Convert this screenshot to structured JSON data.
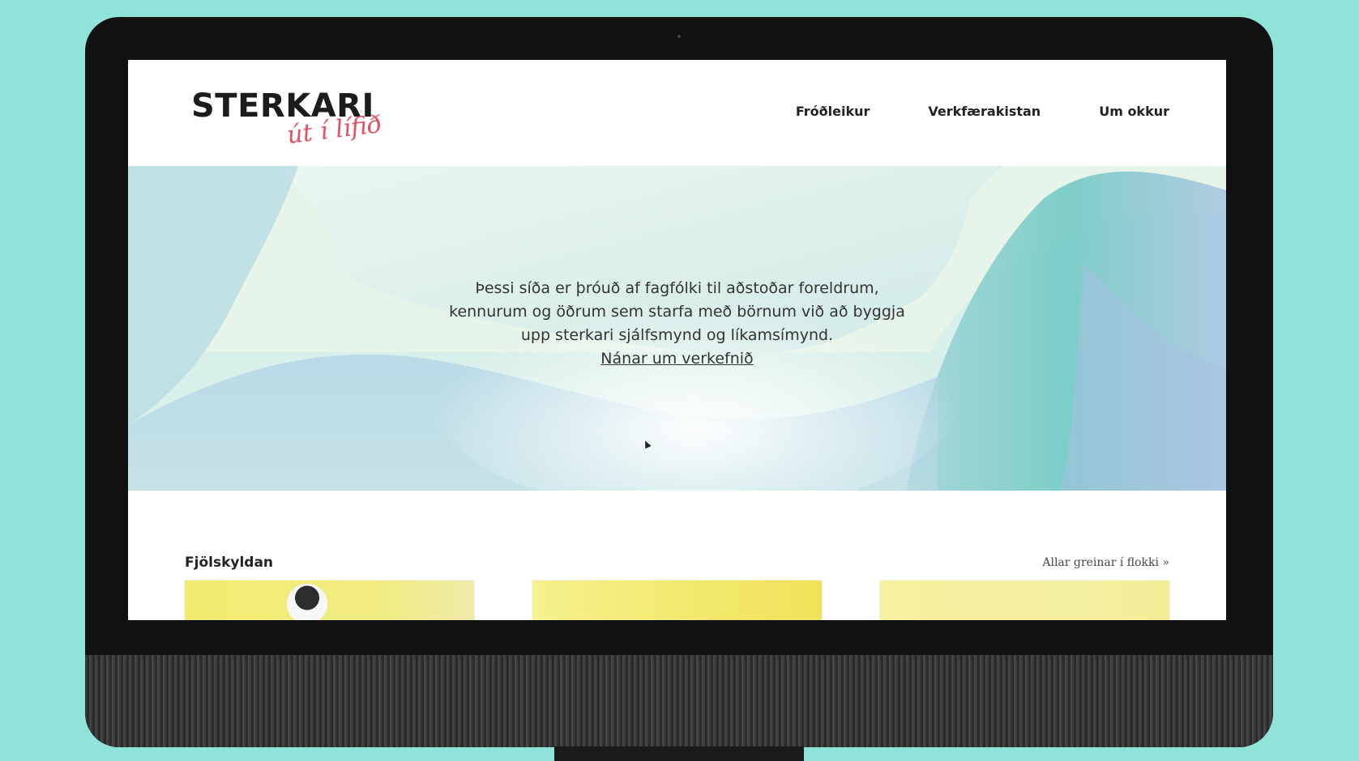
{
  "site": {
    "logo_main": "STERKARI",
    "logo_sub": "út í lífið"
  },
  "nav": {
    "items": [
      "Fróðleikur",
      "Verkfærakistan",
      "Um okkur"
    ]
  },
  "hero": {
    "lines": [
      "Þessi síða er þróuð af fagfólki til aðstoðar foreldrum,",
      "kennurum og öðrum sem starfa með börnum við að byggja",
      "upp sterkari sjálfsmynd og líkamsímynd."
    ],
    "link_label": "Nánar um verkefnið"
  },
  "section": {
    "title": "Fjölskyldan",
    "all_link": "Allar greinar í flokki »"
  },
  "colors": {
    "background": "#8fe3d9",
    "accent": "#e34f63",
    "card_yellow": "#eeea74"
  }
}
